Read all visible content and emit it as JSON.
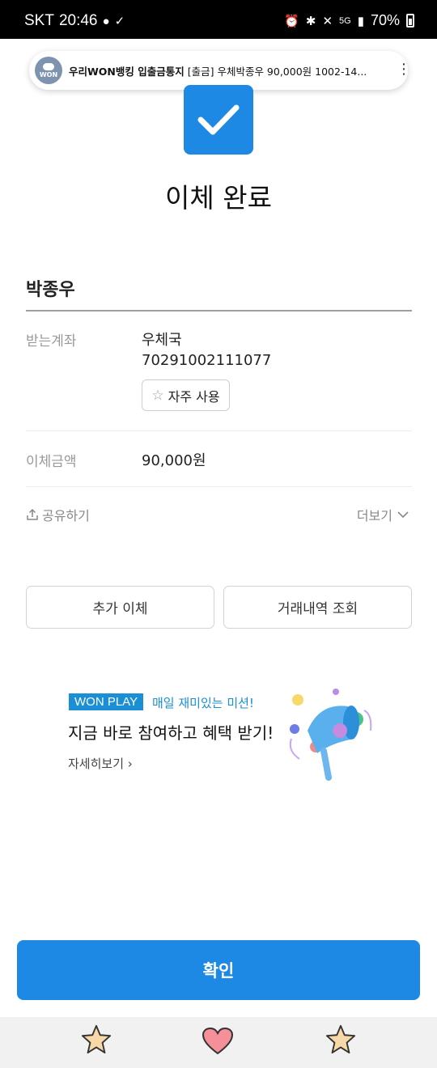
{
  "status_bar": {
    "carrier": "SKT",
    "time": "20:46",
    "battery": "70%",
    "network": "5G"
  },
  "notification": {
    "app": "우리WON뱅킹 입출금통지",
    "message": "[출금] 우체박종우 90,000원 1002-14...",
    "logo_text": "WON"
  },
  "result": {
    "title": "이체 완료",
    "recipient": "박종우"
  },
  "details": {
    "account_label": "받는계좌",
    "bank": "우체국",
    "account_number": "70291002111077",
    "favorite_label": "자주 사용",
    "amount_label": "이체금액",
    "amount": "90,000원"
  },
  "actions": {
    "share_label": "공유하기",
    "more_label": "더보기",
    "additional_transfer": "추가 이체",
    "history": "거래내역 조회"
  },
  "banner": {
    "badge": "WON PLAY",
    "subtitle": "매일 재미있는 미션!",
    "title": "지금 바로 참여하고 혜택 받기!",
    "link": "자세히보기"
  },
  "confirm_label": "확인",
  "colors": {
    "primary": "#1e88e5",
    "badge": "#1a8fd6"
  }
}
